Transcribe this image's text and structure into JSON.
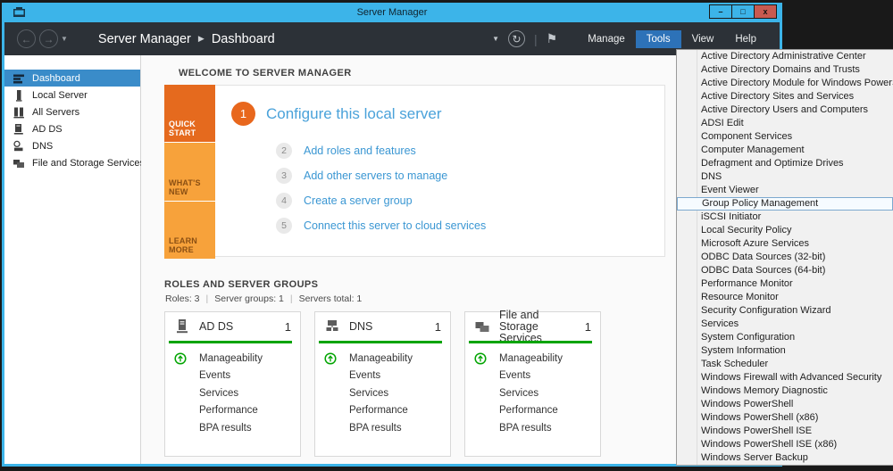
{
  "colors": {
    "chrome_blue": "#3cb4e9",
    "close_red": "#c85a50",
    "navbar_dark": "#2c3137",
    "menu_active_blue": "#2d72b8",
    "sidebar_selected_blue": "#3a8cc9",
    "link_blue": "#3b97d3",
    "orange_dark": "#e56a1e",
    "orange_light": "#f7a23b",
    "status_green": "#00a400"
  },
  "titlebar": {
    "title": "Server Manager",
    "minimize_glyph": "–",
    "maximize_glyph": "□",
    "close_glyph": "x"
  },
  "navbar": {
    "breadcrumb": {
      "root": "Server Manager",
      "separator": "▶",
      "current": "Dashboard"
    },
    "back_glyph": "←",
    "forward_glyph": "→",
    "caret_glyph": "▼",
    "refresh_glyph": "↻",
    "separator_glyph": "|",
    "flag_glyph": "⚑",
    "menu_items": [
      "Manage",
      "Tools",
      "View",
      "Help"
    ],
    "active_menu": "Tools"
  },
  "sidebar": {
    "items": [
      {
        "label": "Dashboard",
        "icon": "dashboard-icon",
        "selected": true,
        "expander": ""
      },
      {
        "label": "Local Server",
        "icon": "local-server-icon",
        "selected": false,
        "expander": ""
      },
      {
        "label": "All Servers",
        "icon": "all-servers-icon",
        "selected": false,
        "expander": ""
      },
      {
        "label": "AD DS",
        "icon": "ad-ds-icon",
        "selected": false,
        "expander": ""
      },
      {
        "label": "DNS",
        "icon": "dns-icon",
        "selected": false,
        "expander": ""
      },
      {
        "label": "File and Storage Services",
        "icon": "storage-icon",
        "selected": false,
        "expander": "▷"
      }
    ]
  },
  "welcome": {
    "header": "WELCOME TO SERVER MANAGER",
    "strip": [
      {
        "label": "QUICK START",
        "tone": "dark"
      },
      {
        "label": "WHAT'S NEW",
        "tone": "light"
      },
      {
        "label": "LEARN MORE",
        "tone": "light"
      }
    ],
    "steps": [
      {
        "num": "1",
        "label": "Configure this local server",
        "primary": true
      },
      {
        "num": "2",
        "label": "Add roles and features",
        "primary": false
      },
      {
        "num": "3",
        "label": "Add other servers to manage",
        "primary": false
      },
      {
        "num": "4",
        "label": "Create a server group",
        "primary": false
      },
      {
        "num": "5",
        "label": "Connect this server to cloud services",
        "primary": false
      }
    ]
  },
  "roles": {
    "header": "ROLES AND SERVER GROUPS",
    "stats": [
      "Roles: 3",
      "Server groups: 1",
      "Servers total: 1"
    ],
    "stats_separator": "|",
    "cards": [
      {
        "title": "AD DS",
        "count": "1",
        "icon": "ad-ds-card-icon",
        "metrics": [
          "Manageability",
          "Events",
          "Services",
          "Performance",
          "BPA results"
        ]
      },
      {
        "title": "DNS",
        "count": "1",
        "icon": "dns-card-icon",
        "metrics": [
          "Manageability",
          "Events",
          "Services",
          "Performance",
          "BPA results"
        ]
      },
      {
        "title": "File and Storage Services",
        "count": "1",
        "icon": "storage-card-icon",
        "metrics": [
          "Manageability",
          "Events",
          "Services",
          "Performance",
          "BPA results"
        ]
      }
    ]
  },
  "tools_menu": {
    "items": [
      "Active Directory Administrative Center",
      "Active Directory Domains and Trusts",
      "Active Directory Module for Windows PowerShell",
      "Active Directory Sites and Services",
      "Active Directory Users and Computers",
      "ADSI Edit",
      "Component Services",
      "Computer Management",
      "Defragment and Optimize Drives",
      "DNS",
      "Event Viewer",
      "Group Policy Management",
      "iSCSI Initiator",
      "Local Security Policy",
      "Microsoft Azure Services",
      "ODBC Data Sources (32-bit)",
      "ODBC Data Sources (64-bit)",
      "Performance Monitor",
      "Resource Monitor",
      "Security Configuration Wizard",
      "Services",
      "System Configuration",
      "System Information",
      "Task Scheduler",
      "Windows Firewall with Advanced Security",
      "Windows Memory Diagnostic",
      "Windows PowerShell",
      "Windows PowerShell (x86)",
      "Windows PowerShell ISE",
      "Windows PowerShell ISE (x86)",
      "Windows Server Backup"
    ],
    "highlighted": "Group Policy Management"
  }
}
